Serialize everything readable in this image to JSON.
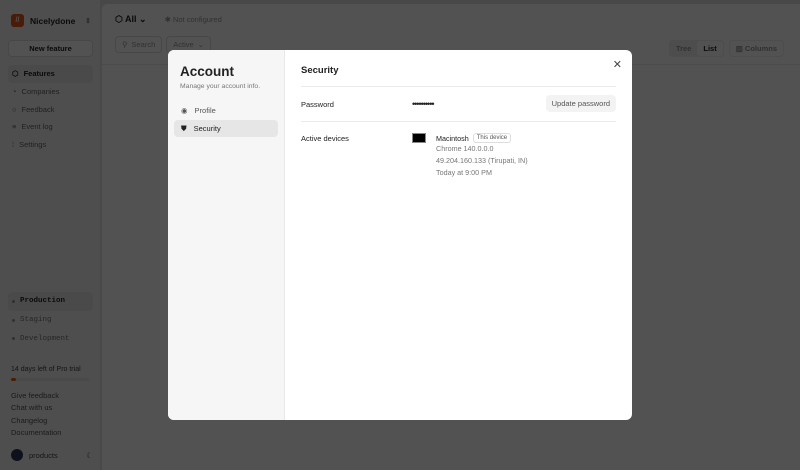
{
  "sidebar": {
    "workspace": "Nicelydone",
    "new_feature": "New feature",
    "nav": [
      "Features",
      "Companies",
      "Feedback",
      "Event log",
      "Settings"
    ],
    "environments": [
      "Production",
      "Staging",
      "Development"
    ],
    "trial": "14 days left of Pro trial",
    "trial_progress": 0.07,
    "links": [
      "Give feedback",
      "Chat with us",
      "Changelog",
      "Documentation"
    ],
    "user": "products"
  },
  "main": {
    "filter": "All",
    "status": "Not configured",
    "search_placeholder": "Search",
    "active_filter": "Active",
    "views": [
      "Tree",
      "List"
    ],
    "columns": "Columns"
  },
  "modal": {
    "title": "Account",
    "subtitle": "Manage your account info.",
    "nav": [
      "Profile",
      "Security"
    ],
    "section": "Security",
    "password_label": "Password",
    "password_value": "••••••••••",
    "update_password": "Update password",
    "devices_label": "Active devices",
    "device": {
      "name": "Macintosh",
      "badge": "This device",
      "browser": "Chrome 140.0.0.0",
      "ip": "49.204.160.133 (Tirupati, IN)",
      "time": "Today at 9:00 PM"
    }
  },
  "colors": {
    "brand": "#e0561c"
  }
}
